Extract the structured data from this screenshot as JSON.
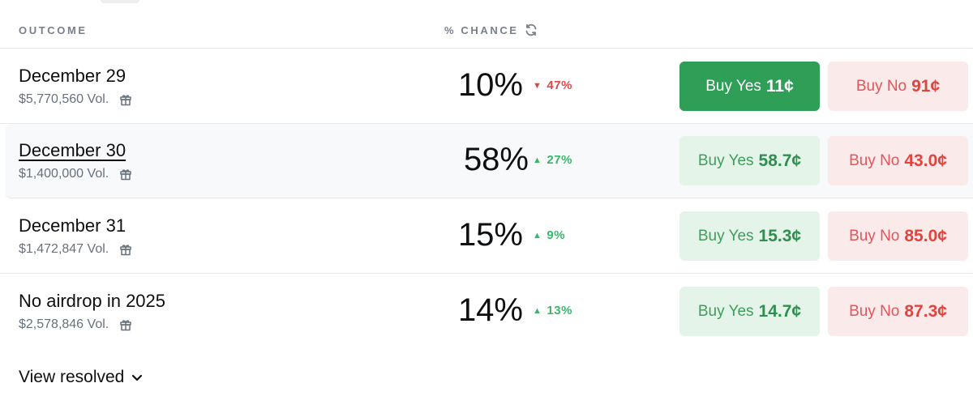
{
  "header": {
    "outcome_label": "OUTCOME",
    "chance_label": "% CHANCE"
  },
  "rows": [
    {
      "name": "December 29",
      "volume": "$5,770,560 Vol.",
      "chance": "10%",
      "delta": "47%",
      "delta_direction": "down",
      "buy_yes_label": "Buy Yes",
      "buy_yes_price": "11¢",
      "buy_no_label": "Buy No",
      "buy_no_price": "91¢"
    },
    {
      "name": "December 30",
      "volume": "$1,400,000 Vol.",
      "chance": "58%",
      "delta": "27%",
      "delta_direction": "up",
      "buy_yes_label": "Buy Yes",
      "buy_yes_price": "58.7¢",
      "buy_no_label": "Buy No",
      "buy_no_price": "43.0¢"
    },
    {
      "name": "December 31",
      "volume": "$1,472,847 Vol.",
      "chance": "15%",
      "delta": "9%",
      "delta_direction": "up",
      "buy_yes_label": "Buy Yes",
      "buy_yes_price": "15.3¢",
      "buy_no_label": "Buy No",
      "buy_no_price": "85.0¢"
    },
    {
      "name": "No airdrop in 2025",
      "volume": "$2,578,846 Vol.",
      "chance": "14%",
      "delta": "13%",
      "delta_direction": "up",
      "buy_yes_label": "Buy Yes",
      "buy_yes_price": "14.7¢",
      "buy_no_label": "Buy No",
      "buy_no_price": "87.3¢"
    }
  ],
  "footer": {
    "view_resolved_label": "View resolved"
  },
  "icons": {
    "refresh": "refresh-icon",
    "gift": "gift-icon",
    "triangle_up": "triangle-up-icon",
    "triangle_down": "triangle-down-icon",
    "chevron": "chevron-down-icon"
  },
  "colors": {
    "yes_active": "#2f9e57",
    "yes_bg": "#e4f4e9",
    "no_bg": "#fbeaea",
    "up": "#3bb56a",
    "down": "#e04848"
  }
}
